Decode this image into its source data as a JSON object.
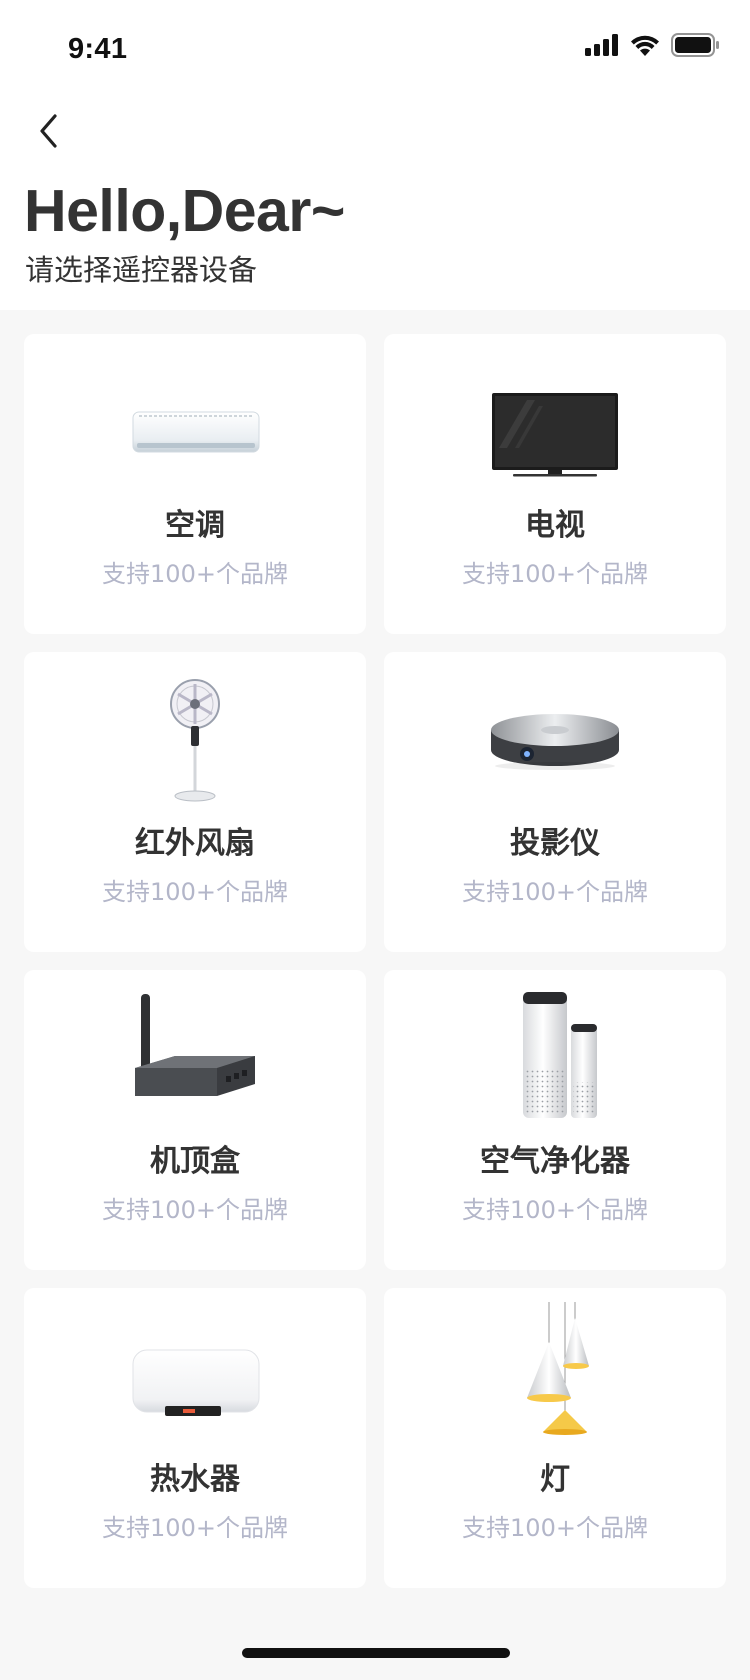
{
  "status_bar": {
    "time": "9:41"
  },
  "header": {
    "greeting": "Hello,Dear~",
    "subtitle": "请选择遥控器设备"
  },
  "devices": [
    {
      "name": "空调",
      "brands": "支持100+个品牌",
      "icon": "air-conditioner"
    },
    {
      "name": "电视",
      "brands": "支持100+个品牌",
      "icon": "television"
    },
    {
      "name": "红外风扇",
      "brands": "支持100+个品牌",
      "icon": "standing-fan"
    },
    {
      "name": "投影仪",
      "brands": "支持100+个品牌",
      "icon": "projector"
    },
    {
      "name": "机顶盒",
      "brands": "支持100+个品牌",
      "icon": "set-top-box"
    },
    {
      "name": "空气净化器",
      "brands": "支持100+个品牌",
      "icon": "air-purifier"
    },
    {
      "name": "热水器",
      "brands": "支持100+个品牌",
      "icon": "water-heater"
    },
    {
      "name": "灯",
      "brands": "支持100+个品牌",
      "icon": "pendant-lamp"
    }
  ],
  "colors": {
    "background": "#f7f7f7",
    "card": "#ffffff",
    "title_text": "#333333",
    "brand_text": "#b3b6c9"
  }
}
